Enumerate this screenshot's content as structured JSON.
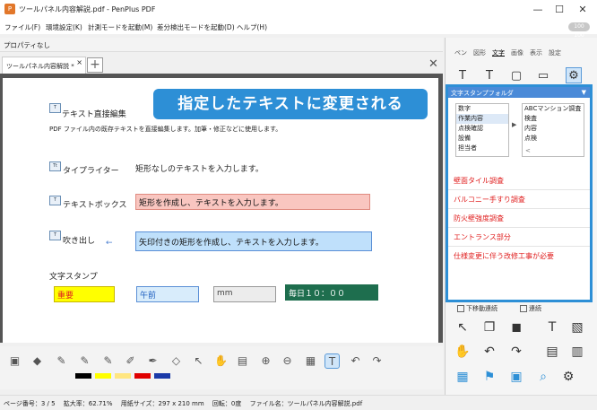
{
  "window": {
    "title": "ツールパネル内容解説.pdf - PenPlus PDF",
    "minimize": "—",
    "maximize": "☐",
    "close": "✕"
  },
  "menu": [
    "ファイル(F)",
    "環境設定(K)",
    "計測モードを起動(M)",
    "差分検出モードを起動(D)",
    "ヘルプ(H)"
  ],
  "badge": "100 100",
  "properties": "プロパティなし",
  "doc_tab": {
    "label": "ツールパネル内容解説 *",
    "close": "×",
    "add": "+"
  },
  "callout": "指定したテキストに変更される",
  "sections": {
    "direct_edit": {
      "title": "テキスト直接編集",
      "desc": "PDF ファイル内の既存テキストを直接編集します。加筆・修正などに使用します。"
    },
    "typewriter": {
      "title": "タイプライター",
      "desc": "矩形なしのテキストを入力します。"
    },
    "textbox": {
      "title": "テキストボックス",
      "desc": "矩形を作成し、テキストを入力します。"
    },
    "balloon": {
      "title": "吹き出し",
      "desc": "矢印付きの矩形を作成し、テキストを入力します。"
    },
    "stamp": {
      "title": "文字スタンプ",
      "stamps": [
        "重要",
        "午前",
        "mm",
        "毎日１０：００"
      ]
    }
  },
  "status": "ページ番号：3 / 5　 拡大率：62.71%　 用紙サイズ：297 x 210 mm　 回転：0度　 ファイル名：ツールパネル内容解説.pdf",
  "right_tabs": [
    "ペン",
    "図形",
    "文字",
    "画像",
    "表示",
    "設定"
  ],
  "stamp_folder": {
    "title": "文字スタンプフォルダ",
    "left_list": [
      "数字",
      "作業内容",
      "点検確認",
      "設備",
      "担当者"
    ],
    "right_list": [
      "ABCマンション調査",
      "検査",
      "内容",
      "点検"
    ],
    "arrow": "▶",
    "back": "<"
  },
  "stamp_items": [
    "壁面タイル調査",
    "バルコニー手すり調査",
    "防火壁強度調査",
    "エントランス部分",
    "仕様変更に伴う改修工事が必要"
  ],
  "checkboxes": [
    "下移動連続",
    "連続"
  ],
  "colors": {
    "accent": "#2d8fd6",
    "stamp_red": "#e02020",
    "textbox_fill": "#f9c6c0",
    "balloon_fill": "#bfe0fb",
    "typewriter_green": "#1e6e4e",
    "stamp_yellow": "#ffff00"
  }
}
